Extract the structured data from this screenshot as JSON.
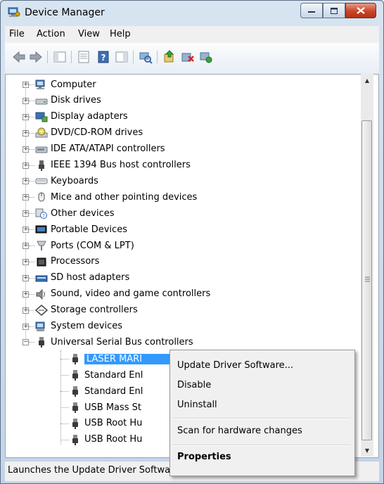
{
  "window": {
    "title": "Device Manager",
    "caption_buttons": [
      "minimize",
      "maximize",
      "close"
    ]
  },
  "menubar": {
    "items": [
      "File",
      "Action",
      "View",
      "Help"
    ]
  },
  "toolbar": {
    "icons": [
      "back-icon",
      "forward-icon",
      "show-hide-console-tree-icon",
      "properties-icon",
      "help-icon",
      "action-pane-icon",
      "scan-hardware-icon",
      "update-driver-icon",
      "uninstall-icon",
      "enable-device-icon"
    ]
  },
  "tree": {
    "categories": [
      {
        "label": "Computer",
        "icon": "computer-icon"
      },
      {
        "label": "Disk drives",
        "icon": "disk-drive-icon"
      },
      {
        "label": "Display adapters",
        "icon": "display-adapter-icon"
      },
      {
        "label": "DVD/CD-ROM drives",
        "icon": "dvd-drive-icon"
      },
      {
        "label": "IDE ATA/ATAPI controllers",
        "icon": "ide-controller-icon"
      },
      {
        "label": "IEEE 1394 Bus host controllers",
        "icon": "ieee1394-icon"
      },
      {
        "label": "Keyboards",
        "icon": "keyboard-icon"
      },
      {
        "label": "Mice and other pointing devices",
        "icon": "mouse-icon"
      },
      {
        "label": "Other devices",
        "icon": "unknown-device-icon"
      },
      {
        "label": "Portable Devices",
        "icon": "portable-device-icon"
      },
      {
        "label": "Ports (COM & LPT)",
        "icon": "port-icon"
      },
      {
        "label": "Processors",
        "icon": "processor-icon"
      },
      {
        "label": "SD host adapters",
        "icon": "sd-adapter-icon"
      },
      {
        "label": "Sound, video and game controllers",
        "icon": "sound-icon"
      },
      {
        "label": "Storage controllers",
        "icon": "storage-controller-icon"
      },
      {
        "label": "System devices",
        "icon": "system-device-icon"
      },
      {
        "label": "Universal Serial Bus controllers",
        "icon": "usb-icon"
      }
    ],
    "usb_children": [
      {
        "label": "LASER MARI",
        "selected": true
      },
      {
        "label": "Standard Enl"
      },
      {
        "label": "Standard Enl"
      },
      {
        "label": "USB Mass St"
      },
      {
        "label": "USB Root Hu"
      },
      {
        "label": "USB Root Hu"
      }
    ]
  },
  "context_menu": {
    "items": [
      {
        "label": "Update Driver Software...",
        "bold": false
      },
      {
        "label": "Disable",
        "bold": false
      },
      {
        "label": "Uninstall",
        "bold": false
      },
      {
        "label": "Scan for hardware changes",
        "bold": false
      },
      {
        "label": "Properties",
        "bold": true
      }
    ]
  },
  "statusbar": {
    "text": "Launches the Update Driver Softwa"
  },
  "colors": {
    "selection": "#3399ff",
    "window_frame": "#c3d4e8",
    "close_button": "#c8452a"
  }
}
